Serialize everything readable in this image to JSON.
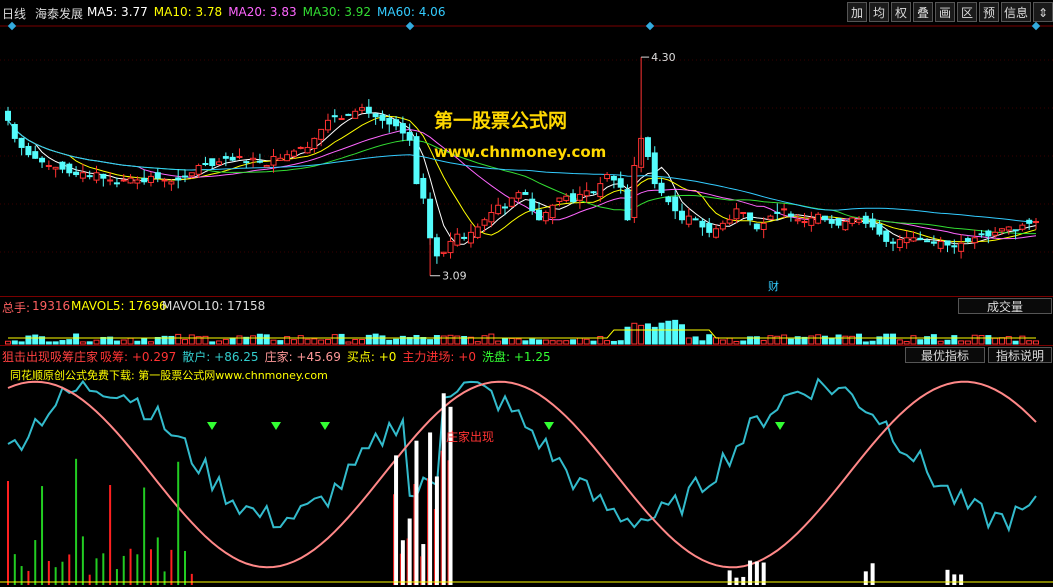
{
  "header": {
    "period": "日线",
    "stock_name": "海泰发展",
    "ma_labels": [
      {
        "text": "MA5: 3.77",
        "color": "#ffffff"
      },
      {
        "text": "MA10: 3.78",
        "color": "#ffff00"
      },
      {
        "text": "MA20: 3.83",
        "color": "#ff66ff"
      },
      {
        "text": "MA30: 3.92",
        "color": "#33dd33"
      },
      {
        "text": "MA60: 4.06",
        "color": "#33ccff"
      }
    ],
    "toolbar": [
      "加",
      "均",
      "权",
      "叠",
      "画",
      "区",
      "预",
      "信息",
      "⇕"
    ]
  },
  "watermark": {
    "cn": "第一股票公式网",
    "url": "www.chnmoney.com"
  },
  "price_panel": {
    "high_label": "4.30",
    "low_label": "3.09",
    "finance_marker": "财"
  },
  "volume_panel": {
    "label": "总手:",
    "value": "19316",
    "mavol5": "MAVOL5: 17696",
    "mavol10": "MAVOL10: 17158",
    "selector": "成交量"
  },
  "indicator_panel": {
    "title": "狙击出现吸筹庄家",
    "items": [
      {
        "text": "吸筹: +0.297",
        "color": "#ff3333"
      },
      {
        "text": "散户: +86.25",
        "color": "#33cccc"
      },
      {
        "text": "庄家: +45.69",
        "color": "#ff9999"
      },
      {
        "text": "买点: +0",
        "color": "#ffff00"
      },
      {
        "text": "主力进场: +0",
        "color": "#ff3333"
      },
      {
        "text": "洗盘: +1.25",
        "color": "#33ff33"
      }
    ],
    "btn_best": "最优指标",
    "btn_explain": "指标说明",
    "sub_caption_a": "同花顺原创公式免费下载:",
    "sub_caption_b": "第一股票公式网www.chnmoney.com",
    "annotation": "庄家出现"
  },
  "chart_data": {
    "type": "candlestick",
    "price_range": [
      3.0,
      4.45
    ],
    "price_high": 4.3,
    "price_low": 3.09,
    "closes": [
      3.95,
      3.85,
      3.8,
      3.76,
      3.74,
      3.72,
      3.7,
      3.69,
      3.68,
      3.66,
      3.65,
      3.66,
      3.64,
      3.66,
      3.63,
      3.62,
      3.6,
      3.62,
      3.63,
      3.62,
      3.61,
      3.64,
      3.63,
      3.62,
      3.61,
      3.62,
      3.64,
      3.66,
      3.7,
      3.71,
      3.7,
      3.72,
      3.74,
      3.73,
      3.75,
      3.72,
      3.74,
      3.72,
      3.7,
      3.75,
      3.74,
      3.76,
      3.78,
      3.8,
      3.8,
      3.85,
      3.9,
      3.95,
      3.97,
      3.96,
      3.98,
      4.0,
      4.02,
      3.99,
      3.97,
      3.95,
      3.93,
      3.92,
      3.88,
      3.84,
      3.6,
      3.52,
      3.3,
      3.2,
      3.22,
      3.28,
      3.32,
      3.3,
      3.33,
      3.36,
      3.4,
      3.44,
      3.48,
      3.47,
      3.52,
      3.55,
      3.54,
      3.45,
      3.4,
      3.44,
      3.48,
      3.52,
      3.53,
      3.5,
      3.54,
      3.56,
      3.55,
      3.6,
      3.65,
      3.62,
      3.58,
      3.4,
      3.7,
      3.85,
      3.75,
      3.6,
      3.55,
      3.5,
      3.45,
      3.4,
      3.42,
      3.4,
      3.36,
      3.33,
      3.35,
      3.38,
      3.4,
      3.46,
      3.44,
      3.4,
      3.35,
      3.38,
      3.42,
      3.44,
      3.46,
      3.42,
      3.4,
      3.39,
      3.41,
      3.43,
      3.4,
      3.38,
      3.37,
      3.39,
      3.41,
      3.4,
      3.38,
      3.36,
      3.32,
      3.28,
      3.27,
      3.29,
      3.3,
      3.3,
      3.29,
      3.28,
      3.27,
      3.28,
      3.26,
      3.25,
      3.27,
      3.28,
      3.3,
      3.32,
      3.31,
      3.33,
      3.35,
      3.36,
      3.34,
      3.37,
      3.38,
      3.39
    ],
    "ma5": 3.77,
    "ma10": 3.78,
    "ma20": 3.83,
    "ma30": 3.92,
    "ma60": 4.06,
    "volume": {
      "total": 19316,
      "mavol5": 17696,
      "mavol10": 17158
    },
    "indicator": {
      "xichou": 0.297,
      "sanhu": 86.25,
      "zhuangjia": 45.69,
      "maidian": 0,
      "zhuli": 0,
      "xipan": 1.25
    }
  },
  "colors": {
    "up": "#ff3232",
    "down": "#54fcfc",
    "frame": "#7a0000",
    "sanhu": "#33bbcc",
    "zhuangjia": "#ff8888"
  }
}
